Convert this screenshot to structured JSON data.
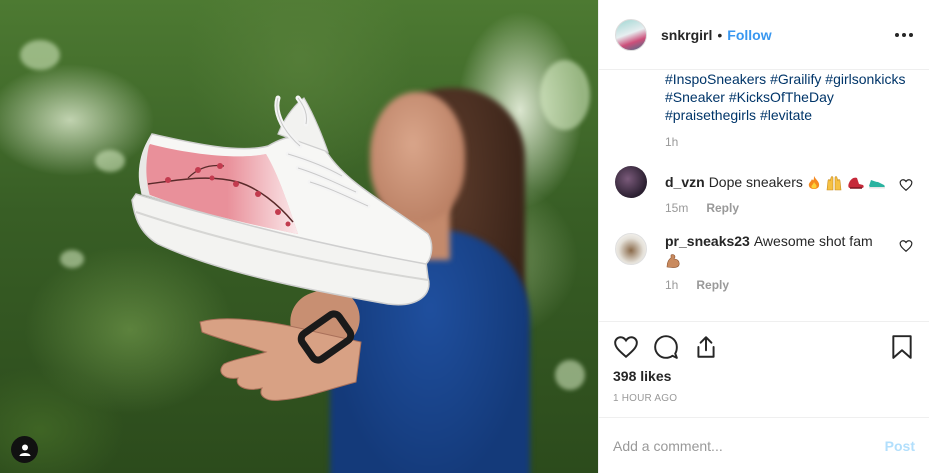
{
  "post": {
    "username": "snkrgirl",
    "separator": "•",
    "follow_label": "Follow",
    "caption_lines": [
      "#InspoSneakers #Grailify #girlsonkicks",
      "#Sneaker #KicksOfTheDay",
      "#praisethegirls #levitate"
    ],
    "caption_time": "1h",
    "likes": "398 likes",
    "posted_ago": "1 HOUR AGO"
  },
  "comments": [
    {
      "user": "d_vzn",
      "text": "Dope sneakers",
      "emojis": [
        "fire",
        "raising-hands",
        "running-shoe-red",
        "sneaker"
      ],
      "time": "15m",
      "reply_label": "Reply"
    },
    {
      "user": "pr_sneaks23",
      "text": "Awesome shot fam",
      "emojis": [
        "flexed-biceps"
      ],
      "time": "1h",
      "reply_label": "Reply"
    }
  ],
  "add_comment": {
    "placeholder": "Add a comment...",
    "post_label": "Post"
  },
  "icons": [
    "more-options-icon",
    "heart-icon",
    "comment-icon",
    "share-icon",
    "bookmark-icon",
    "user-tag-icon"
  ],
  "colors": {
    "link": "#3897f0",
    "hashtag": "#003569",
    "post_disabled": "#b2dffc",
    "muted": "#999999"
  }
}
